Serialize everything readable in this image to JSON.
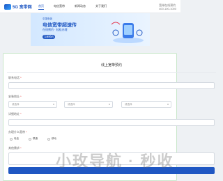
{
  "header": {
    "logo_text": "5G 宽带网",
    "nav": [
      "首页",
      "电信宽带",
      "新闻动态",
      "关于我们"
    ],
    "contact_line1": "宽带在线预约",
    "contact_line2": "400-100-1000"
  },
  "banner": {
    "brand": "中国电信",
    "title": "电信宽带超速传",
    "subtitle": "在线预约 · 轻松办理",
    "button": "立即预约"
  },
  "form": {
    "title": "线上宽带预约",
    "fields": {
      "phone_label": "联系电话",
      "address_label": "安装地址",
      "province_placeholder": "请选择",
      "city_placeholder": "请选择",
      "district_placeholder": "请选择",
      "detail_label": "详细地址",
      "business_label": "办理什么宽带",
      "options": [
        "电信",
        "联通",
        "移动"
      ],
      "remark_label": "其他需求"
    },
    "required_mark": "*"
  },
  "watermark": "小玫导航 · 秒收"
}
